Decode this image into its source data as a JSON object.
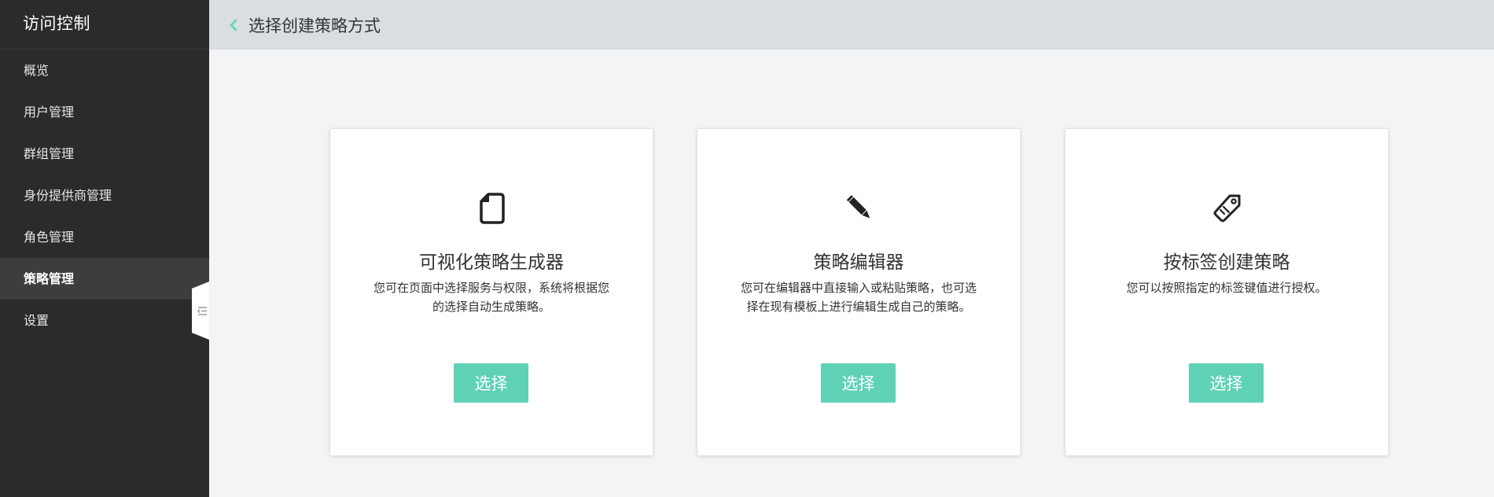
{
  "sidebar": {
    "title": "访问控制",
    "items": [
      {
        "label": "概览",
        "active": false
      },
      {
        "label": "用户管理",
        "active": false
      },
      {
        "label": "群组管理",
        "active": false
      },
      {
        "label": "身份提供商管理",
        "active": false
      },
      {
        "label": "角色管理",
        "active": false
      },
      {
        "label": "策略管理",
        "active": true
      },
      {
        "label": "设置",
        "active": false
      }
    ]
  },
  "header": {
    "back_icon": "chevron-left-icon",
    "title": "选择创建策略方式"
  },
  "cards": [
    {
      "icon": "document-icon",
      "title": "可视化策略生成器",
      "description": "您可在页面中选择服务与权限，系统将根据您的选择自动生成策略。",
      "button_label": "选择"
    },
    {
      "icon": "pencil-icon",
      "title": "策略编辑器",
      "description": "您可在编辑器中直接输入或粘贴策略，也可选择在现有模板上进行编辑生成自己的策略。",
      "button_label": "选择"
    },
    {
      "icon": "tag-icon",
      "title": "按标签创建策略",
      "description": "您可以按照指定的标签键值进行授权。",
      "button_label": "选择"
    }
  ],
  "colors": {
    "accent": "#5fd2b5",
    "sidebar_bg": "#2b2b2b",
    "header_bg": "#d8dee1",
    "page_bg": "#f3f4f5"
  }
}
